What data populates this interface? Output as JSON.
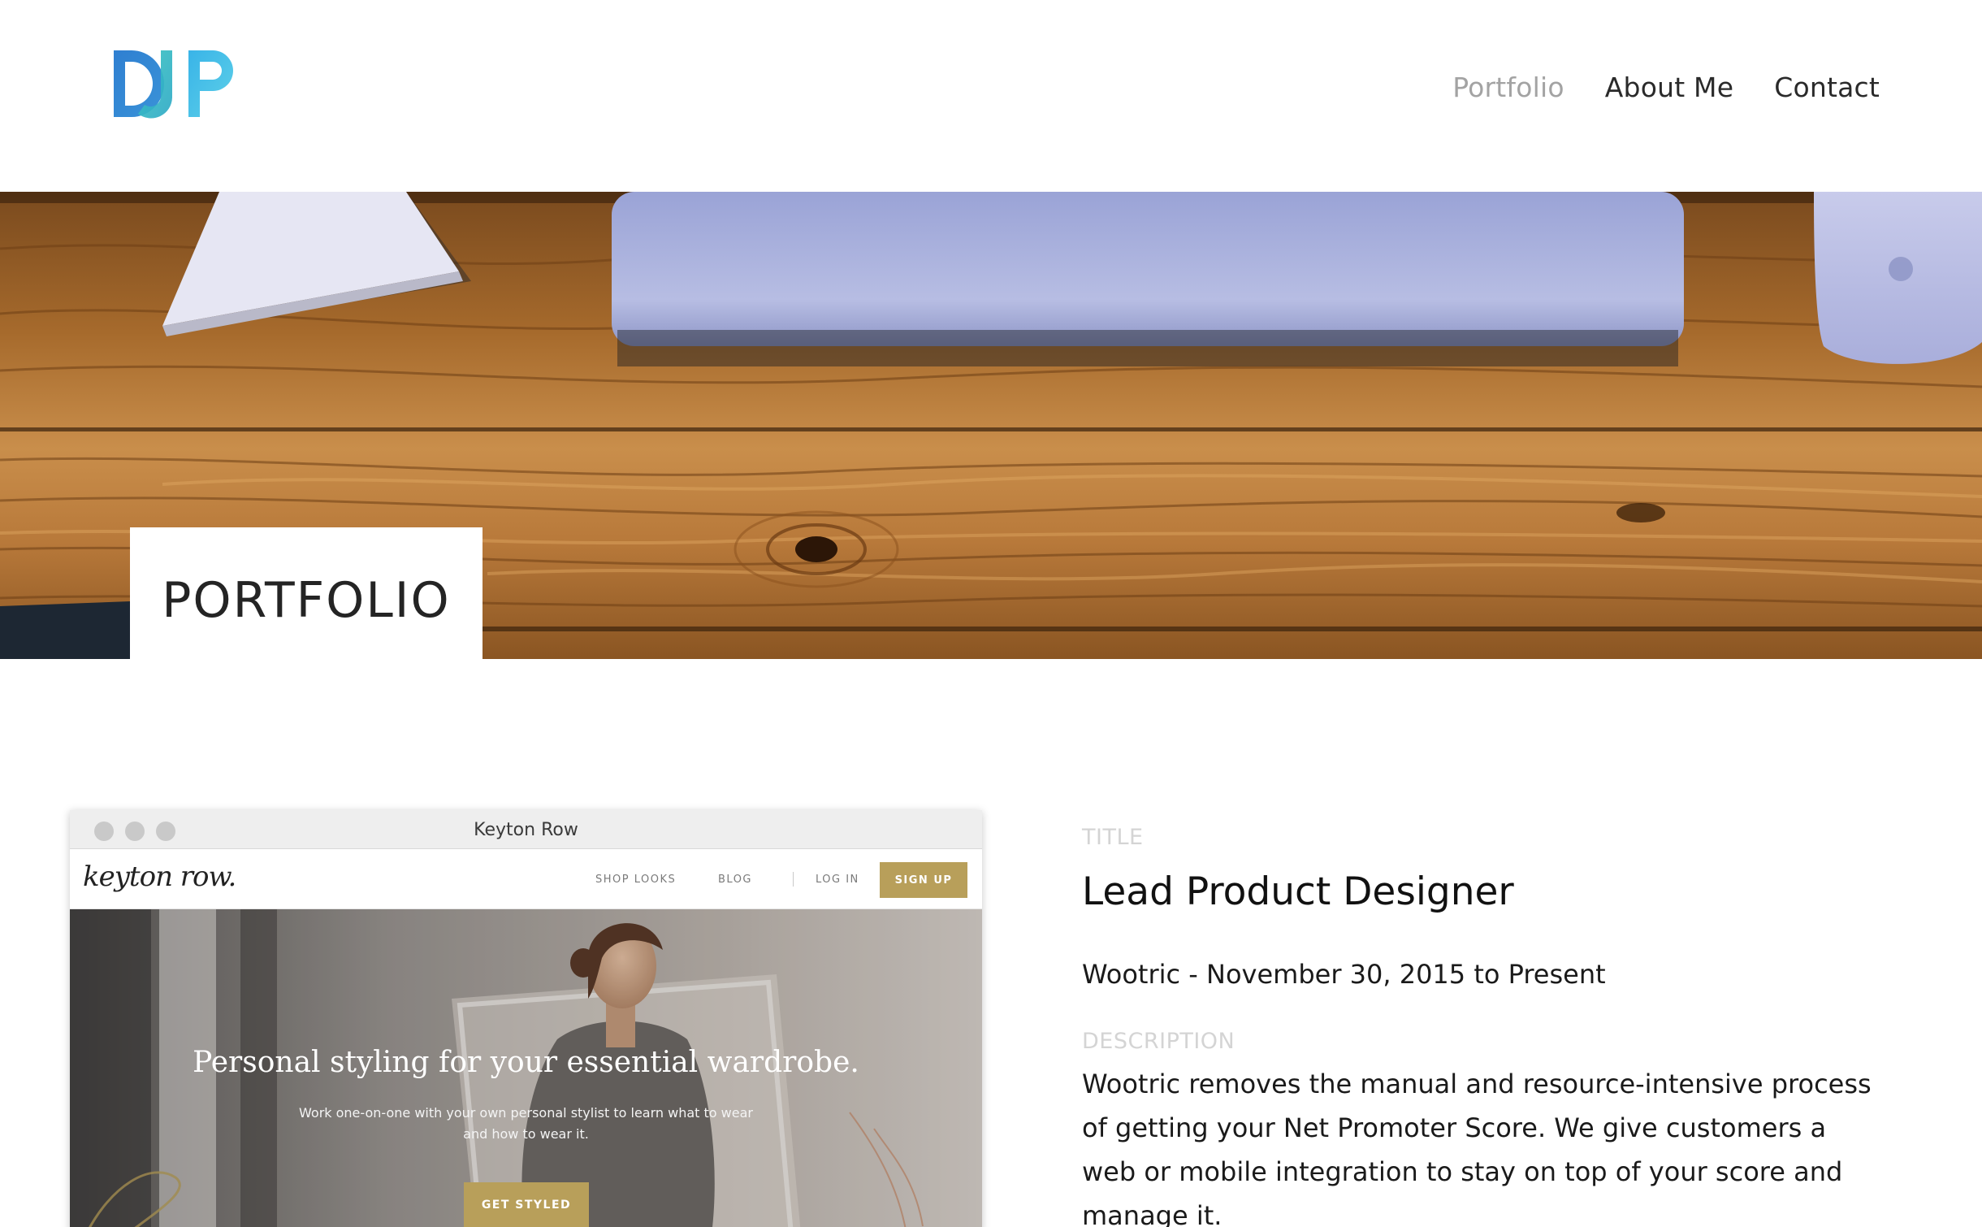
{
  "header": {
    "logo_text": "DJP",
    "nav": [
      {
        "label": "Portfolio",
        "active": true
      },
      {
        "label": "About Me",
        "active": false
      },
      {
        "label": "Contact",
        "active": false
      }
    ]
  },
  "hero": {
    "title": "PORTFOLIO"
  },
  "project_screenshot": {
    "window_title": "Keyton Row",
    "site_logo": "keyton row.",
    "nav_links": [
      "SHOP LOOKS",
      "BLOG",
      "LOG IN"
    ],
    "signup_label": "SIGN UP",
    "headline": "Personal styling for your essential wardrobe.",
    "subheadline": "Work one-on-one with your own personal stylist to learn what to wear and how to wear it.",
    "cta_label": "GET STYLED"
  },
  "details": {
    "title_label": "TITLE",
    "job_title": "Lead Product Designer",
    "company_dates": "Wootric - November 30, 2015 to Present",
    "description_label": "DESCRIPTION",
    "description": "Wootric removes the manual and resource-intensive process of getting your Net Promoter Score. We give customers a web or mobile integration to stay on top of your score and manage it."
  },
  "colors": {
    "nav_active": "#a3a3a3",
    "logo_blue": "#2f7fd1",
    "logo_teal": "#3cc6c0",
    "accent_gold": "#b89f5a",
    "label_gray": "#d4d4d4"
  }
}
